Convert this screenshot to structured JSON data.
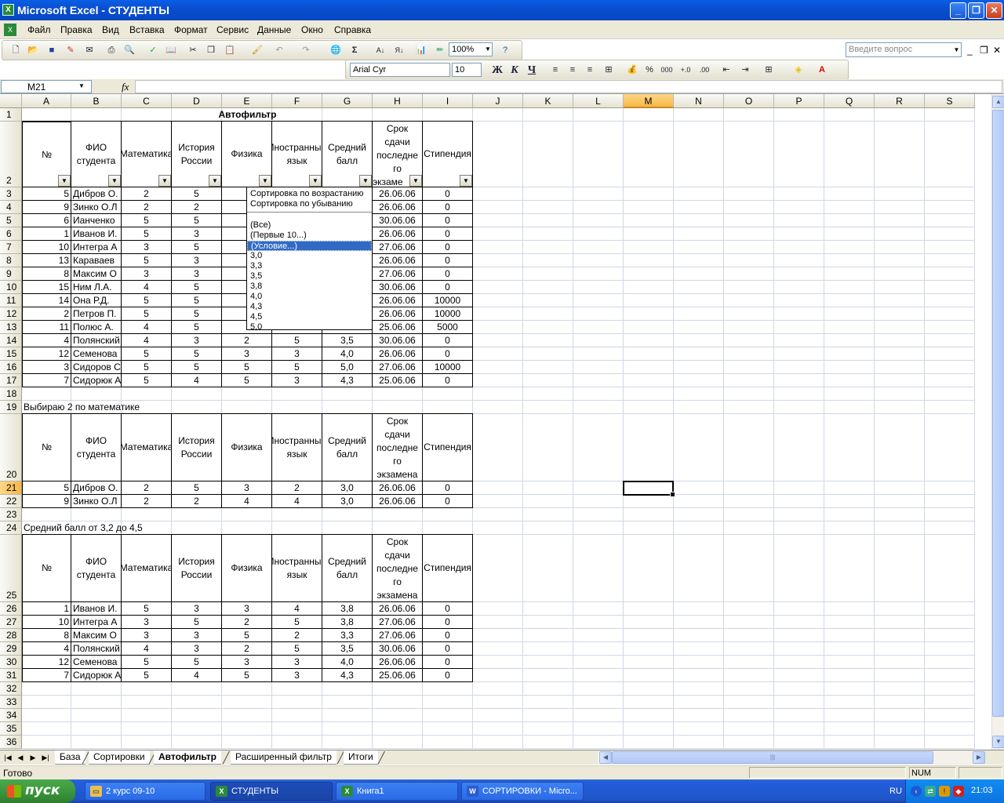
{
  "window": {
    "title": "Microsoft Excel - СТУДЕНТЫ",
    "app_icon": "excel-icon"
  },
  "menu": [
    "Файл",
    "Правка",
    "Вид",
    "Вставка",
    "Формат",
    "Сервис",
    "Данные",
    "Окно",
    "Справка"
  ],
  "help_placeholder": "Введите вопрос",
  "toolbar": {
    "zoom": "100%",
    "font": "Arial Cyr",
    "size": "10",
    "percent": "%",
    "bold": "Ж",
    "italic": "К",
    "underline": "Ч",
    "thousands": "000"
  },
  "name_box": "M21",
  "fx_label": "fx",
  "columns": [
    "A",
    "B",
    "C",
    "D",
    "E",
    "F",
    "G",
    "H",
    "I",
    "J",
    "K",
    "L",
    "M",
    "N",
    "O",
    "P",
    "Q",
    "R",
    "S"
  ],
  "selected_column": "M",
  "selected_row": 21,
  "rows": [
    "1",
    "2",
    "3",
    "4",
    "5",
    "6",
    "7",
    "8",
    "9",
    "10",
    "11",
    "12",
    "13",
    "14",
    "15",
    "16",
    "17",
    "18",
    "19",
    "20",
    "21",
    "22",
    "23",
    "24",
    "25",
    "26",
    "27",
    "28",
    "29",
    "30",
    "31",
    "32",
    "33",
    "34",
    "35",
    "36"
  ],
  "sheet": {
    "title": "Автофильтр",
    "headers": [
      "№",
      "ФИО студента",
      "Математика",
      "История России",
      "Физика",
      "Иностранный язык",
      "Средний балл",
      "Срок сдачи последнего экзамена",
      "Стипендия"
    ],
    "table1": [
      [
        "5",
        "Дибров О.",
        "2",
        "5",
        "",
        "",
        "",
        "26.06.06",
        "0"
      ],
      [
        "9",
        "Зинко О.Л",
        "2",
        "2",
        "",
        "",
        "",
        "26.06.06",
        "0"
      ],
      [
        "6",
        "Ианченко",
        "5",
        "5",
        "",
        "",
        "",
        "30.06.06",
        "0"
      ],
      [
        "1",
        "Иванов И.",
        "5",
        "3",
        "",
        "",
        "",
        "26.06.06",
        "0"
      ],
      [
        "10",
        "Интегра А",
        "3",
        "5",
        "",
        "",
        "",
        "27.06.06",
        "0"
      ],
      [
        "13",
        "Караваев",
        "5",
        "3",
        "",
        "",
        "",
        "26.06.06",
        "0"
      ],
      [
        "8",
        "Максим О",
        "3",
        "3",
        "",
        "",
        "",
        "27.06.06",
        "0"
      ],
      [
        "15",
        "Ним Л.А.",
        "4",
        "5",
        "",
        "",
        "",
        "30.06.06",
        "0"
      ],
      [
        "14",
        "Она Р.Д.",
        "5",
        "5",
        "",
        "",
        "",
        "26.06.06",
        "10000"
      ],
      [
        "2",
        "Петров П.",
        "5",
        "5",
        "",
        "",
        "",
        "26.06.06",
        "10000"
      ],
      [
        "11",
        "Полюс А.",
        "4",
        "5",
        "",
        "",
        "",
        "25.06.06",
        "5000"
      ],
      [
        "4",
        "Полянский",
        "4",
        "3",
        "2",
        "5",
        "3,5",
        "30.06.06",
        "0"
      ],
      [
        "12",
        "Семенова",
        "5",
        "5",
        "3",
        "3",
        "4,0",
        "26.06.06",
        "0"
      ],
      [
        "3",
        "Сидоров С",
        "5",
        "5",
        "5",
        "5",
        "5,0",
        "27.06.06",
        "10000"
      ],
      [
        "7",
        "Сидорюк А",
        "5",
        "4",
        "5",
        "3",
        "4,3",
        "25.06.06",
        "0"
      ]
    ],
    "label2": "Выбираю 2 по математике",
    "table2": [
      [
        "5",
        "Дибров О.",
        "2",
        "5",
        "3",
        "2",
        "3,0",
        "26.06.06",
        "0"
      ],
      [
        "9",
        "Зинко О.Л",
        "2",
        "2",
        "4",
        "4",
        "3,0",
        "26.06.06",
        "0"
      ]
    ],
    "label3": "Средний балл от 3,2 до 4,5",
    "table3": [
      [
        "1",
        "Иванов И.",
        "5",
        "3",
        "3",
        "4",
        "3,8",
        "26.06.06",
        "0"
      ],
      [
        "10",
        "Интегра А",
        "3",
        "5",
        "2",
        "5",
        "3,8",
        "27.06.06",
        "0"
      ],
      [
        "8",
        "Максим О",
        "3",
        "3",
        "5",
        "2",
        "3,3",
        "27.06.06",
        "0"
      ],
      [
        "4",
        "Полянский",
        "4",
        "3",
        "2",
        "5",
        "3,5",
        "30.06.06",
        "0"
      ],
      [
        "12",
        "Семенова",
        "5",
        "5",
        "3",
        "3",
        "4,0",
        "26.06.06",
        "0"
      ],
      [
        "7",
        "Сидорюк А",
        "5",
        "4",
        "5",
        "3",
        "4,3",
        "25.06.06",
        "0"
      ]
    ]
  },
  "header_lines": {
    "no": "№",
    "fio": "ФИО студента",
    "math": "Математика",
    "hist": "История России",
    "phys": "Физика",
    "lang": "Иностранный язык",
    "avg": "Средний балл",
    "deadline_1": "Срок",
    "deadline_2": "сдачи",
    "deadline_3": "последне",
    "deadline_4": "го",
    "deadline_5": "экзамена",
    "deadline_5_cut": "экзаме",
    "stip": "Стипендия"
  },
  "autofilter_menu": [
    "Сортировка по возрастанию",
    "Сортировка по убыванию",
    "(Все)",
    "(Первые 10...)",
    "(Условие...)",
    "3,0",
    "3,3",
    "3,5",
    "3,8",
    "4,0",
    "4,3",
    "4,5",
    "5,0"
  ],
  "autofilter_highlight": "(Условие...)",
  "sheet_tabs": [
    "База",
    "Сортировки",
    "Автофильтр",
    "Расширенный фильтр",
    "Итоги"
  ],
  "active_tab": "Автофильтр",
  "status": {
    "text": "Готово",
    "num": "NUM"
  },
  "taskbar": {
    "start": "пуск",
    "tasks": [
      "2 курс 09-10",
      "СТУДЕНТЫ",
      "Книга1",
      "СОРТИРОВКИ - Micro..."
    ],
    "active_task": "СТУДЕНТЫ",
    "lang": "RU",
    "clock": "21:03"
  }
}
